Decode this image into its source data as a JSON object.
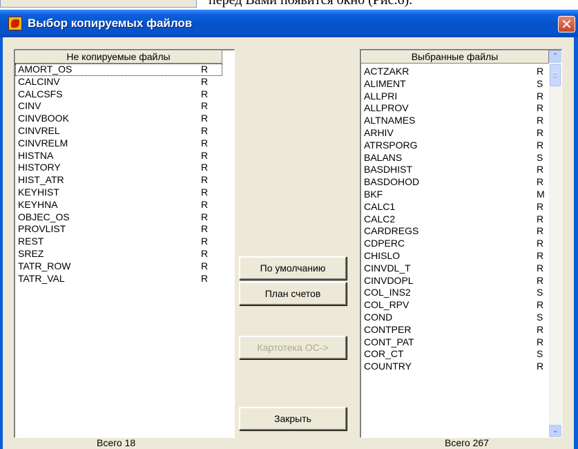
{
  "document": {
    "text": "перед Вами появится окно (Рис.6)."
  },
  "window": {
    "title": "Выбор копируемых файлов",
    "close_glyph": "✕"
  },
  "left_list": {
    "header": "Не копируемые файлы",
    "items": [
      {
        "name": "AMORT_OS",
        "flag": "R"
      },
      {
        "name": "CALCINV",
        "flag": "R"
      },
      {
        "name": "CALCSFS",
        "flag": "R"
      },
      {
        "name": "CINV",
        "flag": "R"
      },
      {
        "name": "CINVBOOK",
        "flag": "R"
      },
      {
        "name": "CINVREL",
        "flag": "R"
      },
      {
        "name": "CINVRELM",
        "flag": "R"
      },
      {
        "name": "HISTNA",
        "flag": "R"
      },
      {
        "name": "HISTORY",
        "flag": "R"
      },
      {
        "name": "HIST_ATR",
        "flag": "R"
      },
      {
        "name": "KEYHIST",
        "flag": "R"
      },
      {
        "name": "KEYHNA",
        "flag": "R"
      },
      {
        "name": "OBJEC_OS",
        "flag": "R"
      },
      {
        "name": "PROVLIST",
        "flag": "R"
      },
      {
        "name": "REST",
        "flag": "R"
      },
      {
        "name": "SREZ",
        "flag": "R"
      },
      {
        "name": "TATR_ROW",
        "flag": "R"
      },
      {
        "name": "TATR_VAL",
        "flag": "R"
      }
    ],
    "total": "Всего 18"
  },
  "right_list": {
    "header": "Выбранные файлы",
    "items": [
      {
        "name": "ACTZAKR",
        "flag": "R"
      },
      {
        "name": "ALIMENT",
        "flag": "S"
      },
      {
        "name": "ALLPRI",
        "flag": "R"
      },
      {
        "name": "ALLPROV",
        "flag": "R"
      },
      {
        "name": "ALTNAMES",
        "flag": "R"
      },
      {
        "name": "ARHIV",
        "flag": "R"
      },
      {
        "name": "ATRSPORG",
        "flag": "R"
      },
      {
        "name": "BALANS",
        "flag": "S"
      },
      {
        "name": "BASDHIST",
        "flag": "R"
      },
      {
        "name": "BASDOHOD",
        "flag": "R"
      },
      {
        "name": "BKF",
        "flag": "M"
      },
      {
        "name": "CALC1",
        "flag": "R"
      },
      {
        "name": "CALC2",
        "flag": "R"
      },
      {
        "name": "CARDREGS",
        "flag": "R"
      },
      {
        "name": "CDPERC",
        "flag": "R"
      },
      {
        "name": "CHISLO",
        "flag": "R"
      },
      {
        "name": "CINVDL_T",
        "flag": "R"
      },
      {
        "name": "CINVDOPL",
        "flag": "R"
      },
      {
        "name": "COL_INS2",
        "flag": "S"
      },
      {
        "name": "COL_RPV",
        "flag": "R"
      },
      {
        "name": "COND",
        "flag": "S"
      },
      {
        "name": "CONTPER",
        "flag": "R"
      },
      {
        "name": "CONT_PAT",
        "flag": "R"
      },
      {
        "name": "COR_CT",
        "flag": "S"
      },
      {
        "name": "COUNTRY",
        "flag": "R"
      }
    ],
    "total": "Всего 267"
  },
  "buttons": {
    "default": "По умолчанию",
    "chart_of_accounts": "План счетов",
    "cards": "Картотека ОС->",
    "close": "Закрыть"
  },
  "scrollbar": {
    "up_glyph": "⌃",
    "down_glyph": "⌄"
  },
  "colors": {
    "titlebar": "#0a5fd8",
    "dialog_face": "#ece9d8",
    "close_button": "#d8553a",
    "disabled_text": "#aca899"
  }
}
